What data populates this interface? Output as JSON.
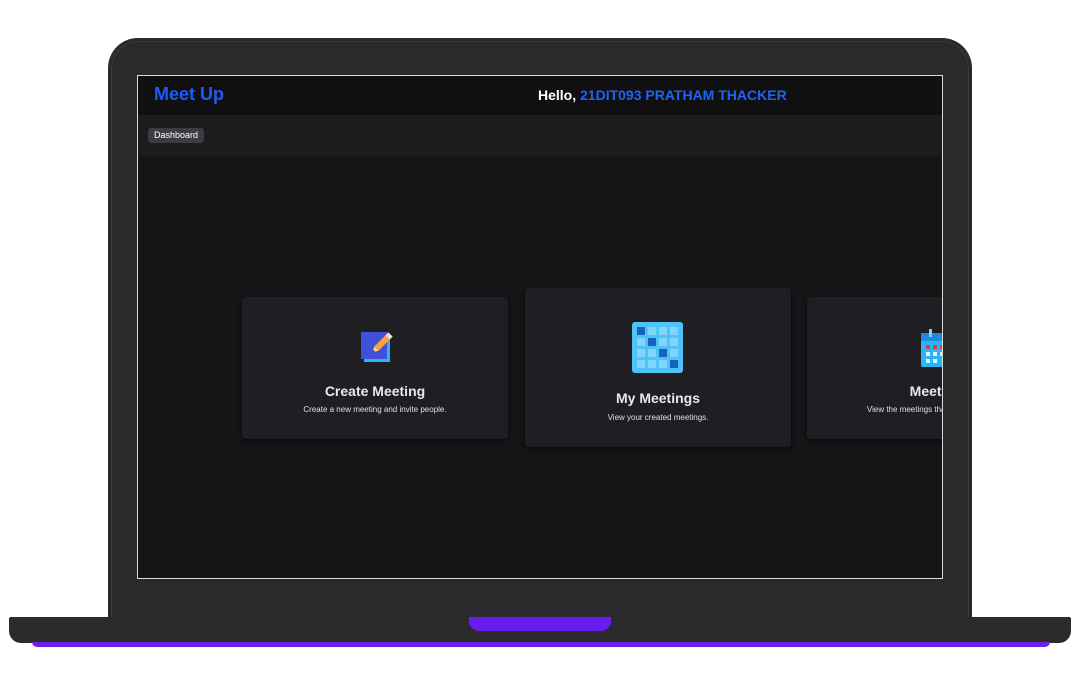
{
  "app": {
    "brand": "Meet Up",
    "greeting_prefix": "Hello,",
    "user_name": "21DIT093 PRATHAM THACKER"
  },
  "nav": {
    "dashboard_label": "Dashboard"
  },
  "cards": [
    {
      "title": "Create Meeting",
      "description": "Create a new meeting and invite people.",
      "icon": "edit-pencil-icon"
    },
    {
      "title": "My Meetings",
      "description": "View your created meetings.",
      "icon": "calendar-grid-icon"
    },
    {
      "title": "Meetings",
      "description": "View the meetings that you are invited to.",
      "icon": "calendar-icon"
    }
  ],
  "colors": {
    "accent": "#1e5af5",
    "screen_background": "#151518",
    "card_background": "#1f1f23",
    "laptop_glow": "#6b21e8"
  }
}
